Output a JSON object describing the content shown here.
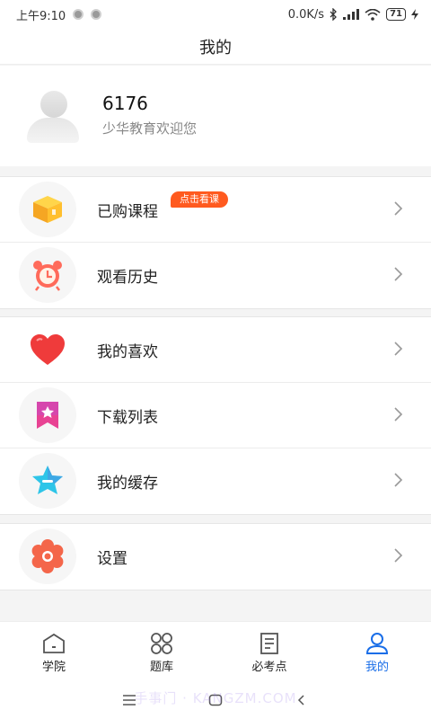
{
  "status_bar": {
    "time": "上午9:10",
    "network_speed": "0.0K/s",
    "battery": "71"
  },
  "header": {
    "title": "我的"
  },
  "profile": {
    "username": "6176",
    "welcome": "少华教育欢迎您"
  },
  "menu": {
    "purchased": {
      "label": "已购课程",
      "badge": "点击看课",
      "icon": "gift-box-icon"
    },
    "history": {
      "label": "观看历史",
      "icon": "alarm-clock-icon"
    },
    "favorites": {
      "label": "我的喜欢",
      "icon": "heart-icon"
    },
    "downloads": {
      "label": "下载列表",
      "icon": "bookmark-star-icon"
    },
    "cache": {
      "label": "我的缓存",
      "icon": "star-icon"
    },
    "settings": {
      "label": "设置",
      "icon": "gear-icon"
    }
  },
  "tabs": [
    {
      "label": "学院",
      "icon": "home-icon"
    },
    {
      "label": "题库",
      "icon": "grid-icon"
    },
    {
      "label": "必考点",
      "icon": "document-icon"
    },
    {
      "label": "我的",
      "icon": "person-icon",
      "active": true
    }
  ],
  "watermark": "手事门 · KANGZM.COM",
  "colors": {
    "accent": "#1a6ee8",
    "badge": "#ff5a1f"
  }
}
